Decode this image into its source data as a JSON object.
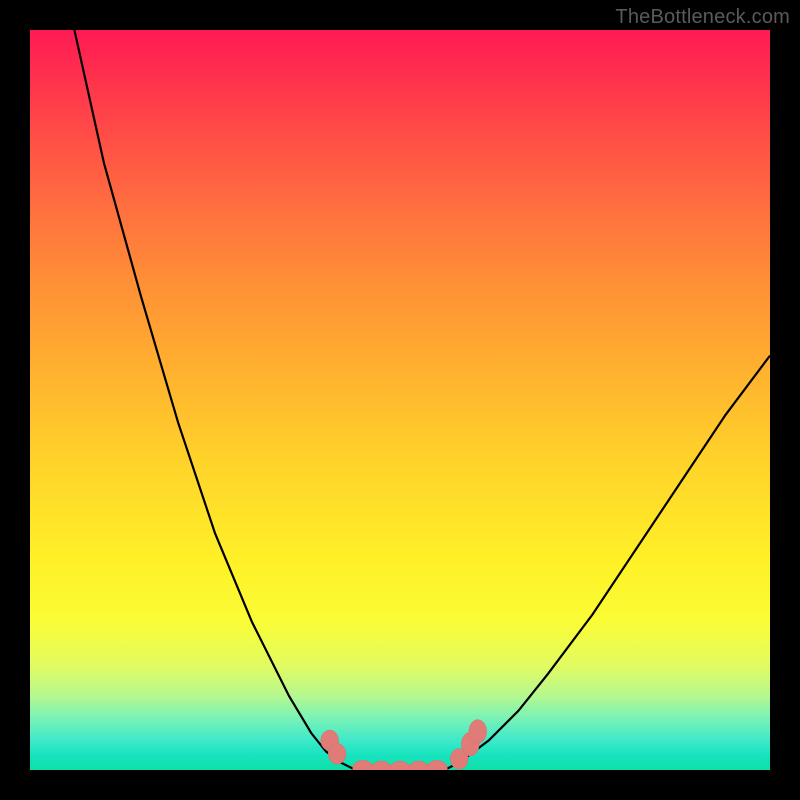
{
  "attribution": "TheBottleneck.com",
  "colors": {
    "frame_bg": "#000000",
    "gradient_top": "#ff1a53",
    "gradient_bottom": "#0fe0a6",
    "curve": "#000000",
    "marker": "#e07b77",
    "attribution_text": "#5a5a5a"
  },
  "chart_data": {
    "type": "line",
    "title": "",
    "xlabel": "",
    "ylabel": "",
    "xlim": [
      0,
      100
    ],
    "ylim": [
      0,
      100
    ],
    "series": [
      {
        "name": "left-branch",
        "x": [
          6,
          10,
          15,
          20,
          25,
          30,
          35,
          38,
          40,
          42,
          44
        ],
        "y": [
          100,
          82,
          64,
          47,
          32,
          20,
          10,
          5,
          2.5,
          1,
          0
        ]
      },
      {
        "name": "valley-floor",
        "x": [
          44,
          46,
          48,
          50,
          52,
          54,
          56
        ],
        "y": [
          0,
          0,
          0,
          0,
          0,
          0,
          0
        ]
      },
      {
        "name": "right-branch",
        "x": [
          56,
          58,
          60,
          62,
          66,
          70,
          76,
          82,
          88,
          94,
          100
        ],
        "y": [
          0,
          1,
          2.5,
          4,
          8,
          13,
          21,
          30,
          39,
          48,
          56
        ]
      }
    ],
    "markers": [
      {
        "x": 40.5,
        "y": 4,
        "rx": 1.2,
        "ry": 1.4
      },
      {
        "x": 41.5,
        "y": 2.2,
        "rx": 1.2,
        "ry": 1.4
      },
      {
        "x": 45,
        "y": 0.2,
        "rx": 1.4,
        "ry": 1.1
      },
      {
        "x": 47.5,
        "y": 0.1,
        "rx": 1.4,
        "ry": 1.1
      },
      {
        "x": 50,
        "y": 0.1,
        "rx": 1.4,
        "ry": 1.1
      },
      {
        "x": 52.5,
        "y": 0.1,
        "rx": 1.4,
        "ry": 1.1
      },
      {
        "x": 55,
        "y": 0.2,
        "rx": 1.4,
        "ry": 1.1
      },
      {
        "x": 58,
        "y": 1.5,
        "rx": 1.2,
        "ry": 1.4
      },
      {
        "x": 59.5,
        "y": 3.5,
        "rx": 1.2,
        "ry": 1.6
      },
      {
        "x": 60.5,
        "y": 5.2,
        "rx": 1.2,
        "ry": 1.6
      }
    ],
    "annotations": []
  }
}
